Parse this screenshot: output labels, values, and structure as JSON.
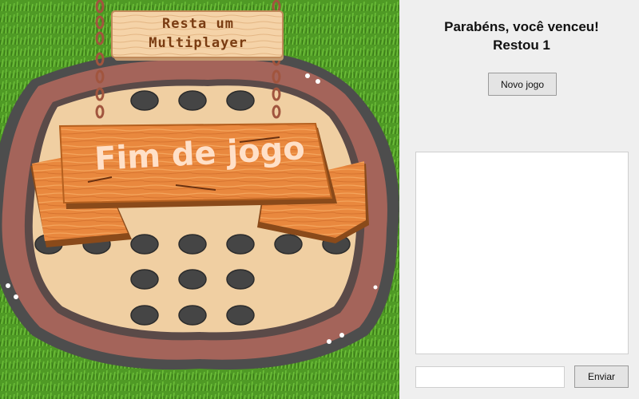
{
  "game": {
    "title_line1": "Resta um",
    "title_line2": "Multiplayer",
    "overlay_text": "Fim de jogo",
    "colors": {
      "grass": "#4f9a25",
      "board_rim": "#a4645a",
      "board_inner": "#f0cfa2",
      "hole": "#454545",
      "plank": "#e9883e"
    }
  },
  "panel": {
    "status_line1": "Parabéns, você venceu!",
    "status_line2": "Restou 1",
    "new_game_label": "Novo jogo",
    "chat_input_value": "",
    "send_label": "Enviar"
  }
}
